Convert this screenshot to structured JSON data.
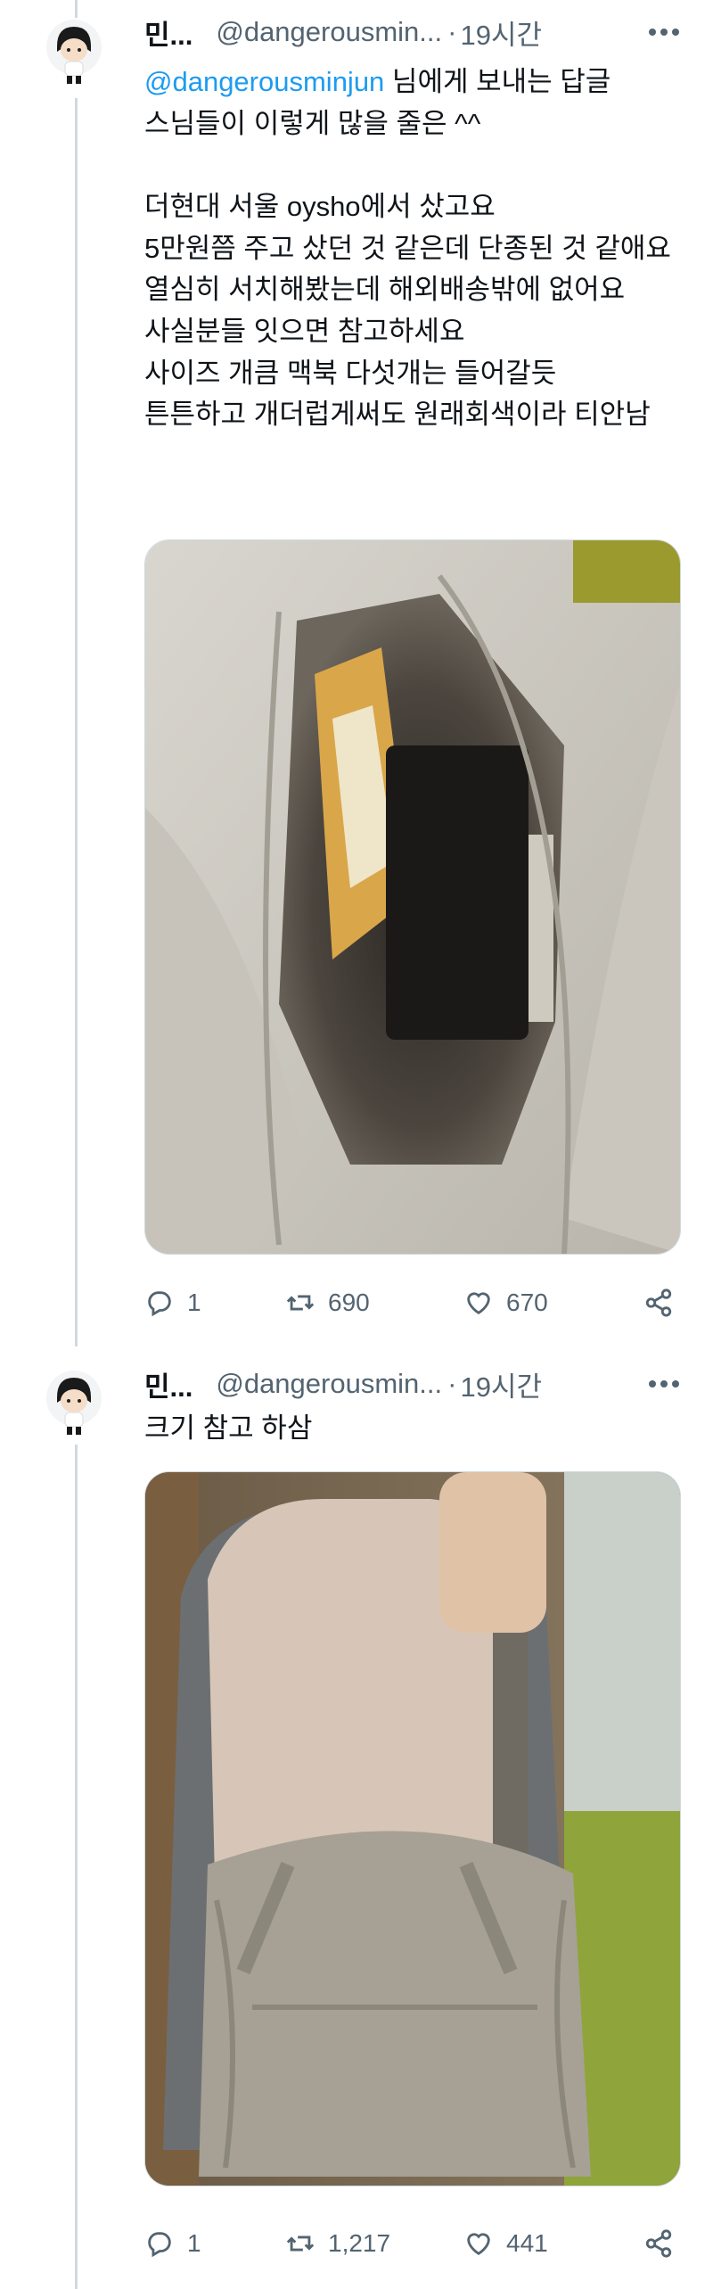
{
  "tweets": [
    {
      "name": "민...",
      "handle": "@dangerousmin...",
      "separator": "·",
      "time": "19시간",
      "replying_mention": "@dangerousminjun",
      "replying_suffix": " 님에게 보내는 답글",
      "text": "스님들이 이렇게 많을 줄은 ^^\n\n더현대 서울 oysho에서 샀고요\n5만원쯤 주고 샀던 것 같은데 단종된 것 같애요\n열심히 서치해봤는데 해외배송밖에 없어요\n사실분들 잇으면 참고하세요\n사이즈 개큼 맥북 다섯개는 들어갈듯\n튼튼하고 개더럽게써도 원래회색이라 티안남",
      "replies": "1",
      "retweets": "690",
      "likes": "670"
    },
    {
      "name": "민...",
      "handle": "@dangerousmin...",
      "separator": "·",
      "time": "19시간",
      "text": "크기 참고 하삼",
      "replies": "1",
      "retweets": "1,217",
      "likes": "441"
    }
  ],
  "icons": {
    "more": "more-icon",
    "reply": "reply-icon",
    "retweet": "retweet-icon",
    "like": "heart-icon",
    "share": "share-icon"
  },
  "colors": {
    "text": "#0f1419",
    "secondary": "#536471",
    "link": "#1d9bf0",
    "thread_line": "#cfd9de"
  }
}
